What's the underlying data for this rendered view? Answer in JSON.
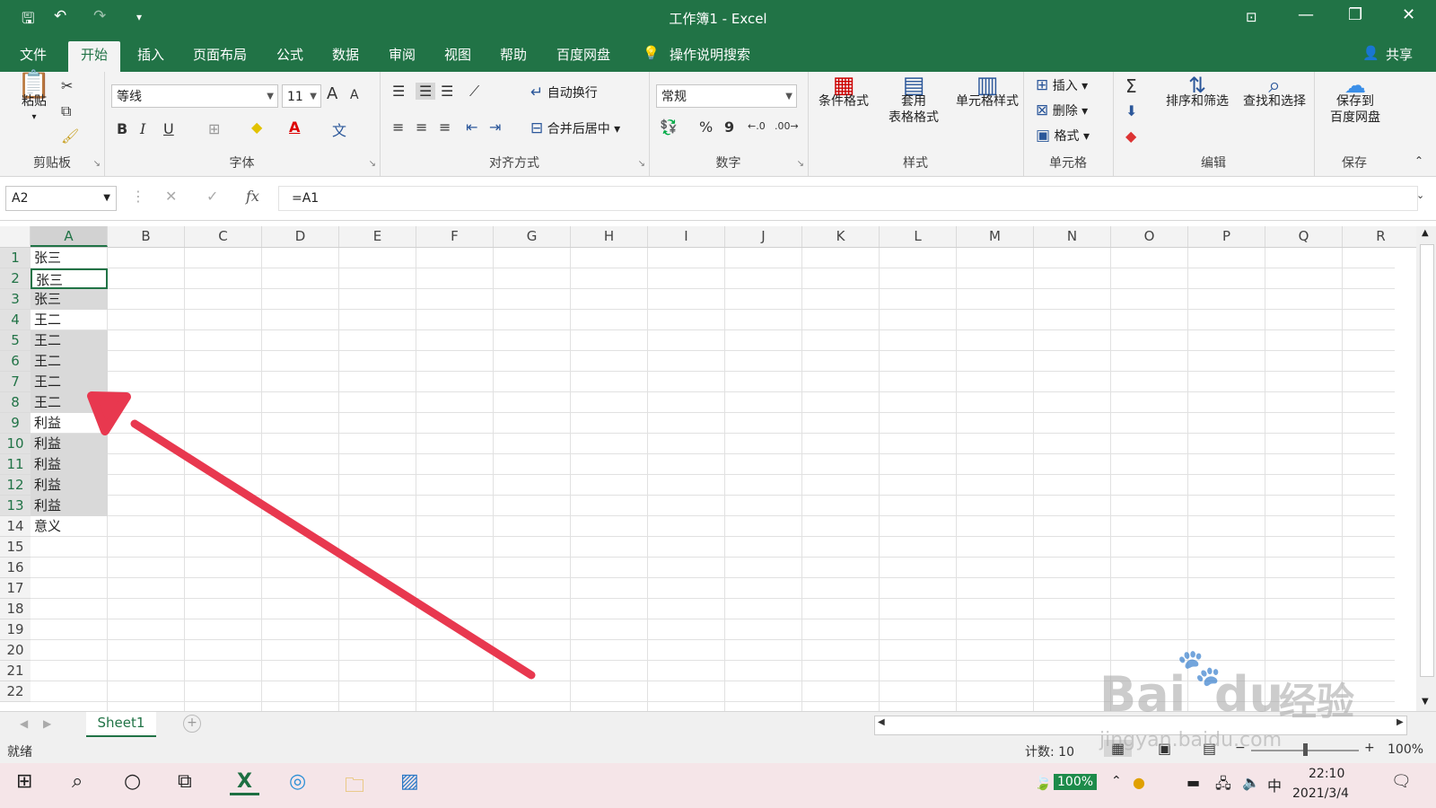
{
  "window": {
    "title": "工作簿1  -  Excel",
    "controls": {
      "minimize": "—",
      "restore": "❐",
      "close": "✕"
    }
  },
  "quick_access": {
    "save_icon": "save-icon",
    "undo_icon": "undo-icon",
    "redo_icon": "redo-icon"
  },
  "menu_tabs": [
    {
      "label": "文件"
    },
    {
      "label": "开始"
    },
    {
      "label": "插入"
    },
    {
      "label": "页面布局"
    },
    {
      "label": "公式"
    },
    {
      "label": "数据"
    },
    {
      "label": "审阅"
    },
    {
      "label": "视图"
    },
    {
      "label": "帮助"
    },
    {
      "label": "百度网盘"
    }
  ],
  "search_tell": "操作说明搜索",
  "share": "共享",
  "ribbon": {
    "clipboard": {
      "paste": "粘贴",
      "label": "剪贴板"
    },
    "font": {
      "name": "等线",
      "size": "11",
      "label": "字体",
      "bold": "B",
      "italic": "I",
      "underline": "U",
      "grow": "A",
      "shrink": "A"
    },
    "align": {
      "wrap": "自动换行",
      "merge": "合并后居中",
      "label": "对齐方式"
    },
    "number": {
      "format": "常规",
      "percent": "%",
      "comma": "9",
      "label": "数字"
    },
    "styles": {
      "cond": "条件格式",
      "table1": "套用",
      "table2": "表格格式",
      "cell": "单元格样式",
      "label": "样式"
    },
    "cells": {
      "insert": "插入",
      "delete": "删除",
      "format": "格式",
      "label": "单元格"
    },
    "editing": {
      "sort": "排序和筛选",
      "find": "查找和选择",
      "label": "编辑"
    },
    "save": {
      "line1": "保存到",
      "line2": "百度网盘",
      "label": "保存"
    }
  },
  "formula_bar": {
    "name_box": "A2",
    "fx": "fx",
    "cancel": "✕",
    "enter": "✓",
    "formula": "=A1"
  },
  "columns": [
    "A",
    "B",
    "C",
    "D",
    "E",
    "F",
    "G",
    "H",
    "I",
    "J",
    "K",
    "L",
    "M",
    "N",
    "O",
    "P",
    "Q",
    "R"
  ],
  "rows": [
    "1",
    "2",
    "3",
    "4",
    "5",
    "6",
    "7",
    "8",
    "9",
    "10",
    "11",
    "12",
    "13",
    "14",
    "15",
    "16",
    "17",
    "18",
    "19",
    "20",
    "21",
    "22"
  ],
  "cells_A": [
    "张三",
    "张三",
    "张三",
    "王二",
    "王二",
    "王二",
    "王二",
    "王二",
    "利益",
    "利益",
    "利益",
    "利益",
    "利益",
    "意义"
  ],
  "sheet": {
    "name": "Sheet1",
    "add": "+"
  },
  "status": {
    "ready": "就绪",
    "count": "计数: 10",
    "zoom": "100%"
  },
  "taskbar": {
    "time": "22:10",
    "date": "2021/3/4",
    "battery": "100%",
    "ime": "中"
  },
  "watermark": {
    "text1": "Bai",
    "text2": "du",
    "text3": "经验",
    "url": "jingyan.baidu.com"
  },
  "arrow_color": "#e8384f",
  "accent_color": "#217346"
}
